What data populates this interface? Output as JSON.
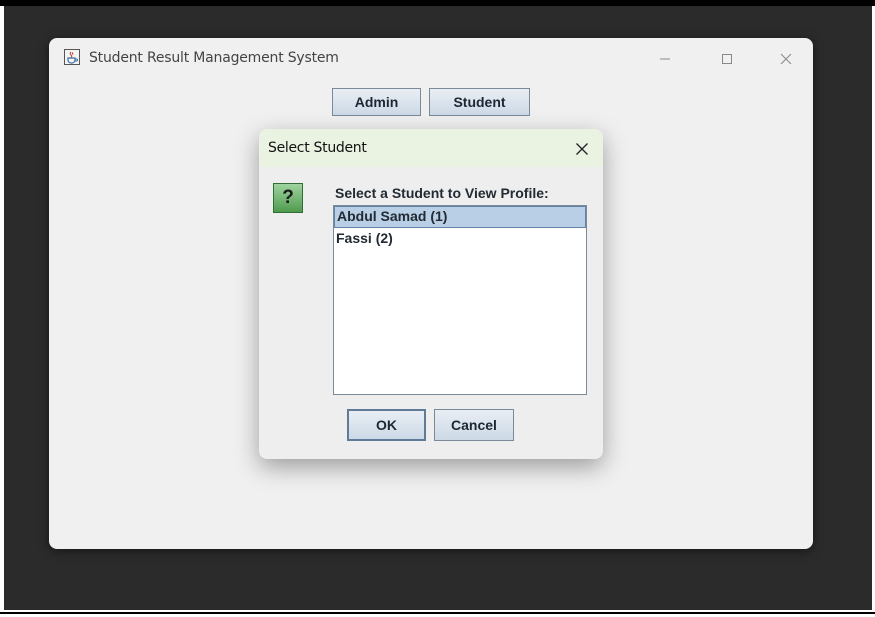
{
  "main_window": {
    "title": "Student Result Management System",
    "icons": {
      "app": "java-cup-icon",
      "minimize": "minimize-icon",
      "maximize": "maximize-icon",
      "close": "close-icon"
    },
    "buttons": {
      "admin": "Admin",
      "student": "Student"
    }
  },
  "dialog": {
    "title": "Select Student",
    "icon": "question-icon",
    "question_glyph": "?",
    "prompt": "Select a Student to View Profile:",
    "students": [
      {
        "label": "Abdul Samad (1)",
        "selected": true
      },
      {
        "label": "Fassi  (2)",
        "selected": false
      }
    ],
    "ok_label": "OK",
    "cancel_label": "Cancel"
  },
  "colors": {
    "dialog_titlebar": "#eaf2e1",
    "selection": "#b8cfe5",
    "button_border": "#7a8a99",
    "desktop": "#2b2b2b"
  }
}
